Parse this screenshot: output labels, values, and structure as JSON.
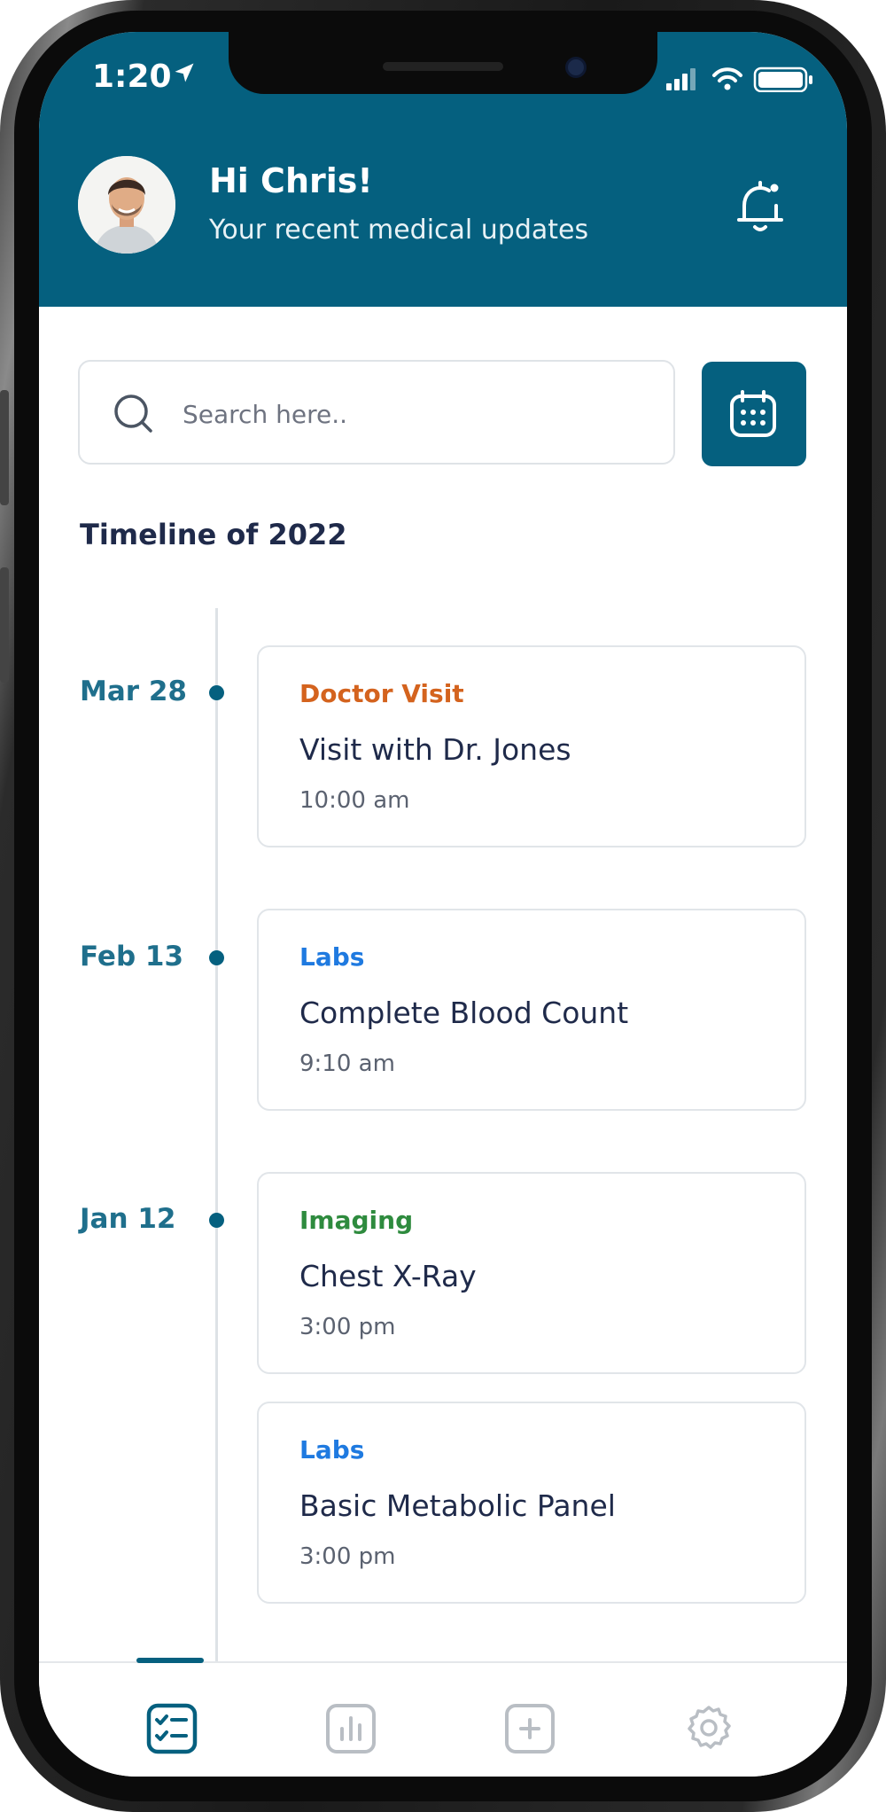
{
  "status_bar": {
    "time": "1:20"
  },
  "header": {
    "greeting": "Hi Chris!",
    "subtitle": "Your recent medical updates"
  },
  "search": {
    "placeholder": "Search here.."
  },
  "timeline": {
    "title": "Timeline of 2022",
    "groups": [
      {
        "date": "Mar 28",
        "entries": [
          {
            "category": "Doctor Visit",
            "category_color": "#d4631e",
            "title": "Visit with Dr. Jones",
            "time": "10:00 am"
          }
        ]
      },
      {
        "date": "Feb 13",
        "entries": [
          {
            "category": "Labs",
            "category_color": "#1f7ae0",
            "title": "Complete Blood Count",
            "time": "9:10 am"
          }
        ]
      },
      {
        "date": "Jan 12",
        "entries": [
          {
            "category": "Imaging",
            "category_color": "#2e8b3e",
            "title": "Chest X-Ray",
            "time": "3:00 pm"
          },
          {
            "category": "Labs",
            "category_color": "#1f7ae0",
            "title": "Basic Metabolic Panel",
            "time": "3:00 pm"
          }
        ]
      }
    ]
  },
  "bottom_nav": {
    "items": [
      {
        "icon": "timeline-checklist-icon",
        "active": true
      },
      {
        "icon": "bar-chart-icon",
        "active": false
      },
      {
        "icon": "plus-square-icon",
        "active": false
      },
      {
        "icon": "gear-icon",
        "active": false
      }
    ]
  },
  "colors": {
    "brand": "#05607f",
    "text_dark": "#1f2a4a",
    "date_text": "#1f6f8c"
  }
}
